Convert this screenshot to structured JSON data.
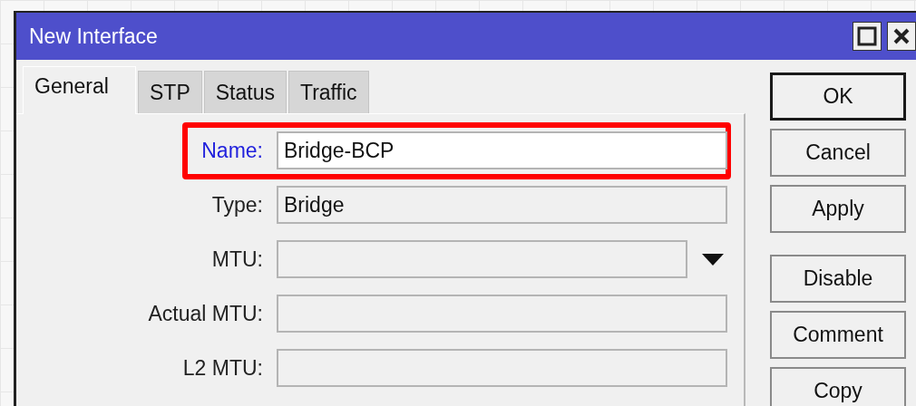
{
  "window": {
    "title": "New Interface"
  },
  "tabs": [
    {
      "label": "General",
      "selected": true
    },
    {
      "label": "STP",
      "selected": false
    },
    {
      "label": "Status",
      "selected": false
    },
    {
      "label": "Traffic",
      "selected": false
    }
  ],
  "fields": [
    {
      "kind": "text",
      "label": "Name:",
      "value": "Bridge-BCP",
      "highlighted": true,
      "read_only": false
    },
    {
      "kind": "text",
      "label": "Type:",
      "value": "Bridge",
      "highlighted": false,
      "read_only": true
    },
    {
      "kind": "dropdown",
      "label": "MTU:",
      "highlighted": false,
      "read_only": true
    },
    {
      "kind": "text",
      "label": "Actual MTU:",
      "highlighted": false,
      "read_only": true
    },
    {
      "kind": "text",
      "label": "L2 MTU:",
      "highlighted": false,
      "read_only": true
    }
  ],
  "button_groups": [
    [
      {
        "label": "OK",
        "default": true
      },
      {
        "label": "Cancel",
        "default": false
      },
      {
        "label": "Apply",
        "default": false
      }
    ],
    [
      {
        "label": "Disable",
        "default": false
      },
      {
        "label": "Comment",
        "default": false
      },
      {
        "label": "Copy",
        "default": false
      }
    ]
  ]
}
